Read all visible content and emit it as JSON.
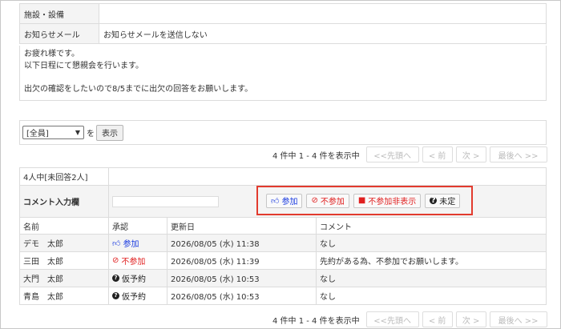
{
  "info": {
    "facility_label": "施設・設備",
    "facility_value": "",
    "notify_label": "お知らせメール",
    "notify_value": "お知らせメールを送信しない",
    "message_lines": [
      "お疲れ様です。",
      "以下日程にて懇親会を行います。",
      "",
      "出欠の確認をしたいので8/5までに出欠の回答をお願いします。"
    ]
  },
  "filter": {
    "select_value": "[全員]",
    "wo_label": "を",
    "show_button": "表示"
  },
  "pager": {
    "count_text": "4 件中 1 - 4 件を表示中",
    "first": "<<先頭へ",
    "prev": "< 前",
    "next": "次 >",
    "last": "最後へ >>"
  },
  "attendance": {
    "summary": "4人中[未回答2人]",
    "comment_label": "コメント入力欄",
    "actions": {
      "join": "参加",
      "decline": "不参加",
      "hide_decline": "不参加非表示",
      "undecided": "未定"
    },
    "columns": [
      "名前",
      "承認",
      "更新日",
      "コメント"
    ],
    "rows": [
      {
        "name": "デモ　太郎",
        "status": "参加",
        "status_type": "join",
        "date": "2026/08/05 (水) 11:38",
        "comment": "なし"
      },
      {
        "name": "三田　太郎",
        "status": "不参加",
        "status_type": "decline",
        "date": "2026/08/05 (水) 11:39",
        "comment": "先約がある為、不参加でお願いします。"
      },
      {
        "name": "大門　太郎",
        "status": "仮予約",
        "status_type": "tentative",
        "date": "2026/08/05 (水) 10:53",
        "comment": "なし"
      },
      {
        "name": "青島　太郎",
        "status": "仮予約",
        "status_type": "tentative",
        "date": "2026/08/05 (水) 10:53",
        "comment": "なし"
      }
    ]
  },
  "colors": {
    "highlight_border": "#e23b2e",
    "join": "#1a3be0",
    "decline": "#e02020"
  }
}
